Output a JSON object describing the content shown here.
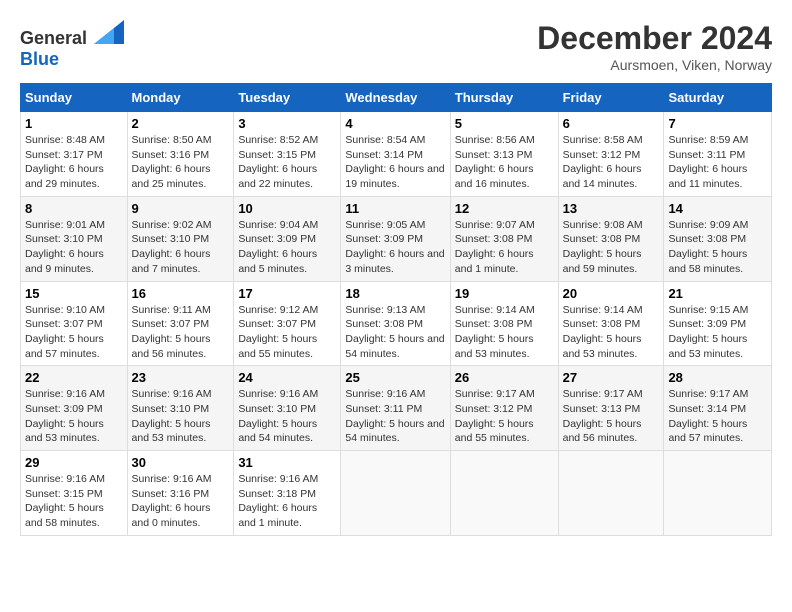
{
  "header": {
    "logo_general": "General",
    "logo_blue": "Blue",
    "month": "December 2024",
    "location": "Aursmoen, Viken, Norway"
  },
  "weekdays": [
    "Sunday",
    "Monday",
    "Tuesday",
    "Wednesday",
    "Thursday",
    "Friday",
    "Saturday"
  ],
  "weeks": [
    [
      {
        "day": "1",
        "sunrise": "Sunrise: 8:48 AM",
        "sunset": "Sunset: 3:17 PM",
        "daylight": "Daylight: 6 hours and 29 minutes."
      },
      {
        "day": "2",
        "sunrise": "Sunrise: 8:50 AM",
        "sunset": "Sunset: 3:16 PM",
        "daylight": "Daylight: 6 hours and 25 minutes."
      },
      {
        "day": "3",
        "sunrise": "Sunrise: 8:52 AM",
        "sunset": "Sunset: 3:15 PM",
        "daylight": "Daylight: 6 hours and 22 minutes."
      },
      {
        "day": "4",
        "sunrise": "Sunrise: 8:54 AM",
        "sunset": "Sunset: 3:14 PM",
        "daylight": "Daylight: 6 hours and 19 minutes."
      },
      {
        "day": "5",
        "sunrise": "Sunrise: 8:56 AM",
        "sunset": "Sunset: 3:13 PM",
        "daylight": "Daylight: 6 hours and 16 minutes."
      },
      {
        "day": "6",
        "sunrise": "Sunrise: 8:58 AM",
        "sunset": "Sunset: 3:12 PM",
        "daylight": "Daylight: 6 hours and 14 minutes."
      },
      {
        "day": "7",
        "sunrise": "Sunrise: 8:59 AM",
        "sunset": "Sunset: 3:11 PM",
        "daylight": "Daylight: 6 hours and 11 minutes."
      }
    ],
    [
      {
        "day": "8",
        "sunrise": "Sunrise: 9:01 AM",
        "sunset": "Sunset: 3:10 PM",
        "daylight": "Daylight: 6 hours and 9 minutes."
      },
      {
        "day": "9",
        "sunrise": "Sunrise: 9:02 AM",
        "sunset": "Sunset: 3:10 PM",
        "daylight": "Daylight: 6 hours and 7 minutes."
      },
      {
        "day": "10",
        "sunrise": "Sunrise: 9:04 AM",
        "sunset": "Sunset: 3:09 PM",
        "daylight": "Daylight: 6 hours and 5 minutes."
      },
      {
        "day": "11",
        "sunrise": "Sunrise: 9:05 AM",
        "sunset": "Sunset: 3:09 PM",
        "daylight": "Daylight: 6 hours and 3 minutes."
      },
      {
        "day": "12",
        "sunrise": "Sunrise: 9:07 AM",
        "sunset": "Sunset: 3:08 PM",
        "daylight": "Daylight: 6 hours and 1 minute."
      },
      {
        "day": "13",
        "sunrise": "Sunrise: 9:08 AM",
        "sunset": "Sunset: 3:08 PM",
        "daylight": "Daylight: 5 hours and 59 minutes."
      },
      {
        "day": "14",
        "sunrise": "Sunrise: 9:09 AM",
        "sunset": "Sunset: 3:08 PM",
        "daylight": "Daylight: 5 hours and 58 minutes."
      }
    ],
    [
      {
        "day": "15",
        "sunrise": "Sunrise: 9:10 AM",
        "sunset": "Sunset: 3:07 PM",
        "daylight": "Daylight: 5 hours and 57 minutes."
      },
      {
        "day": "16",
        "sunrise": "Sunrise: 9:11 AM",
        "sunset": "Sunset: 3:07 PM",
        "daylight": "Daylight: 5 hours and 56 minutes."
      },
      {
        "day": "17",
        "sunrise": "Sunrise: 9:12 AM",
        "sunset": "Sunset: 3:07 PM",
        "daylight": "Daylight: 5 hours and 55 minutes."
      },
      {
        "day": "18",
        "sunrise": "Sunrise: 9:13 AM",
        "sunset": "Sunset: 3:08 PM",
        "daylight": "Daylight: 5 hours and 54 minutes."
      },
      {
        "day": "19",
        "sunrise": "Sunrise: 9:14 AM",
        "sunset": "Sunset: 3:08 PM",
        "daylight": "Daylight: 5 hours and 53 minutes."
      },
      {
        "day": "20",
        "sunrise": "Sunrise: 9:14 AM",
        "sunset": "Sunset: 3:08 PM",
        "daylight": "Daylight: 5 hours and 53 minutes."
      },
      {
        "day": "21",
        "sunrise": "Sunrise: 9:15 AM",
        "sunset": "Sunset: 3:09 PM",
        "daylight": "Daylight: 5 hours and 53 minutes."
      }
    ],
    [
      {
        "day": "22",
        "sunrise": "Sunrise: 9:16 AM",
        "sunset": "Sunset: 3:09 PM",
        "daylight": "Daylight: 5 hours and 53 minutes."
      },
      {
        "day": "23",
        "sunrise": "Sunrise: 9:16 AM",
        "sunset": "Sunset: 3:10 PM",
        "daylight": "Daylight: 5 hours and 53 minutes."
      },
      {
        "day": "24",
        "sunrise": "Sunrise: 9:16 AM",
        "sunset": "Sunset: 3:10 PM",
        "daylight": "Daylight: 5 hours and 54 minutes."
      },
      {
        "day": "25",
        "sunrise": "Sunrise: 9:16 AM",
        "sunset": "Sunset: 3:11 PM",
        "daylight": "Daylight: 5 hours and 54 minutes."
      },
      {
        "day": "26",
        "sunrise": "Sunrise: 9:17 AM",
        "sunset": "Sunset: 3:12 PM",
        "daylight": "Daylight: 5 hours and 55 minutes."
      },
      {
        "day": "27",
        "sunrise": "Sunrise: 9:17 AM",
        "sunset": "Sunset: 3:13 PM",
        "daylight": "Daylight: 5 hours and 56 minutes."
      },
      {
        "day": "28",
        "sunrise": "Sunrise: 9:17 AM",
        "sunset": "Sunset: 3:14 PM",
        "daylight": "Daylight: 5 hours and 57 minutes."
      }
    ],
    [
      {
        "day": "29",
        "sunrise": "Sunrise: 9:16 AM",
        "sunset": "Sunset: 3:15 PM",
        "daylight": "Daylight: 5 hours and 58 minutes."
      },
      {
        "day": "30",
        "sunrise": "Sunrise: 9:16 AM",
        "sunset": "Sunset: 3:16 PM",
        "daylight": "Daylight: 6 hours and 0 minutes."
      },
      {
        "day": "31",
        "sunrise": "Sunrise: 9:16 AM",
        "sunset": "Sunset: 3:18 PM",
        "daylight": "Daylight: 6 hours and 1 minute."
      },
      null,
      null,
      null,
      null
    ]
  ]
}
